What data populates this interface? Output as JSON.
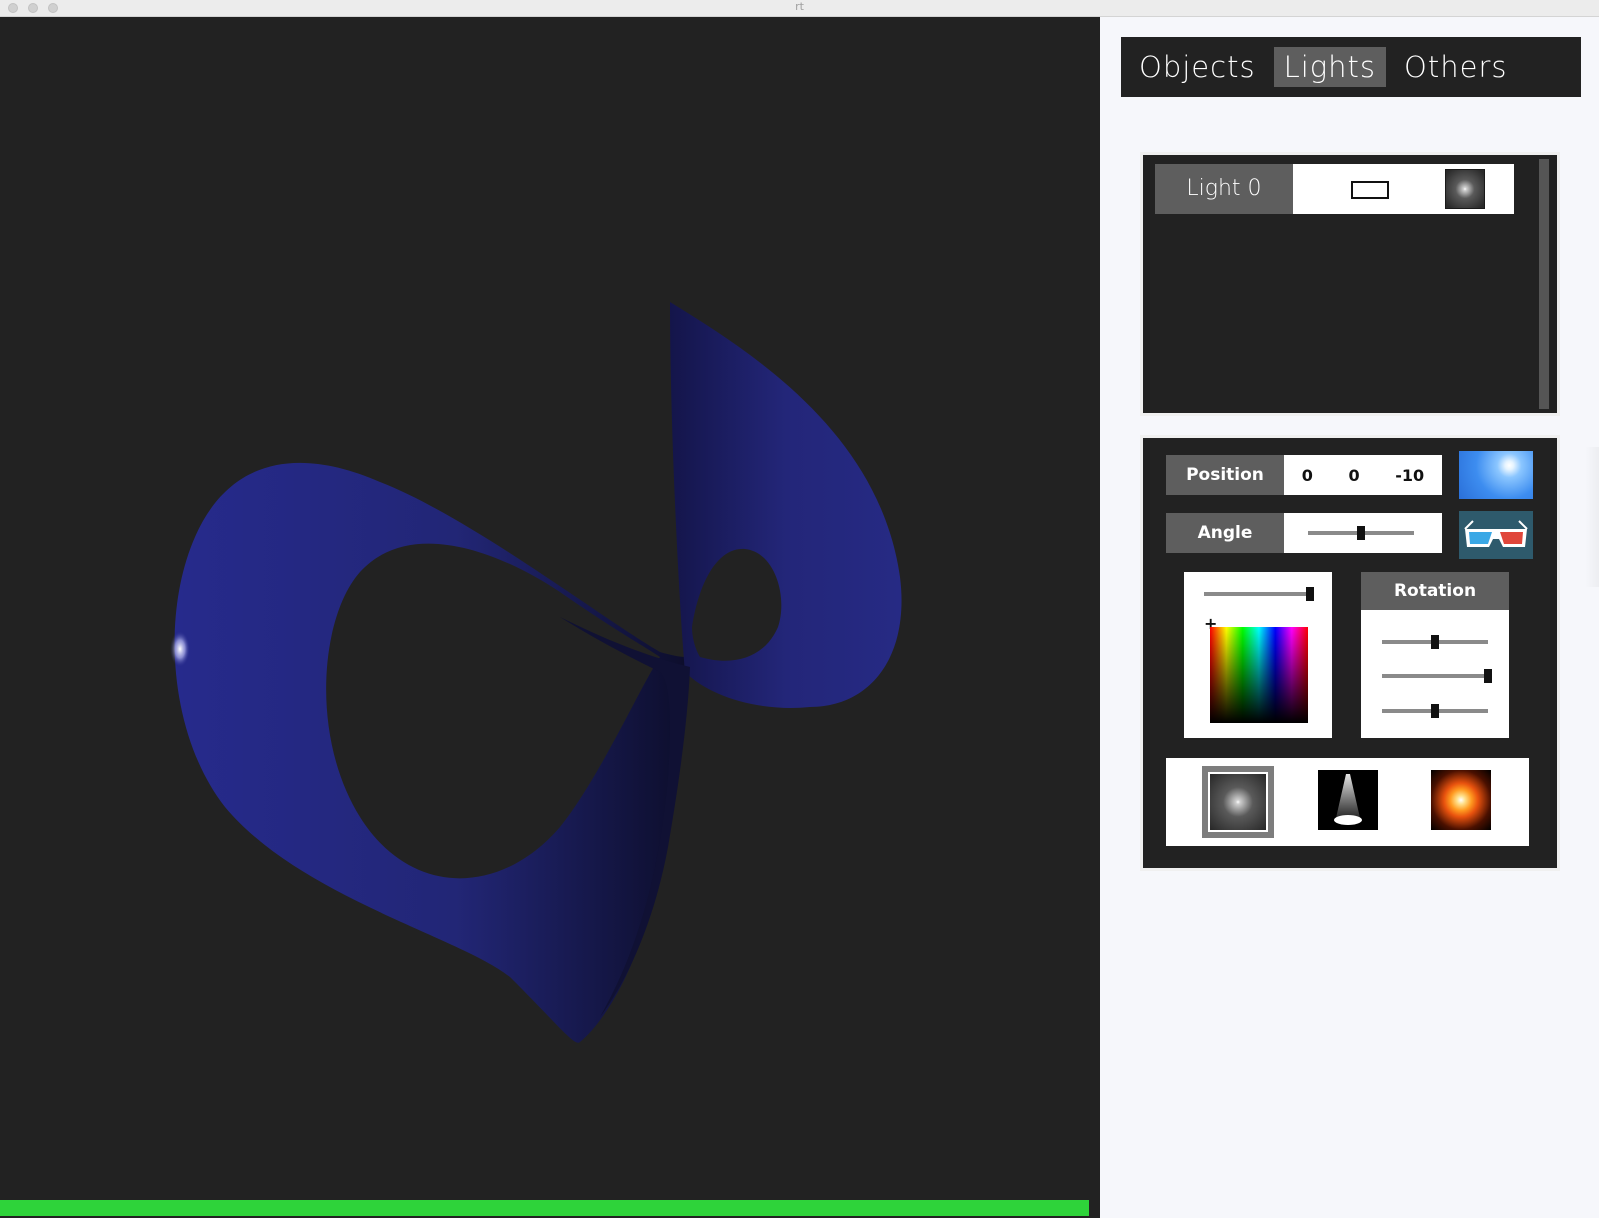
{
  "window": {
    "title": "rt"
  },
  "tabs": [
    {
      "label": "Objects",
      "active": false
    },
    {
      "label": "Lights",
      "active": true
    },
    {
      "label": "Others",
      "active": false
    }
  ],
  "lights_list": {
    "items": [
      {
        "label": "Light 0",
        "shape_icon": "rectangle-icon",
        "preview_icon": "point-light-icon"
      }
    ]
  },
  "properties": {
    "position": {
      "label": "Position",
      "x": "0",
      "y": "0",
      "z": "-10"
    },
    "angle": {
      "label": "Angle",
      "value": 0.5
    },
    "color": {
      "brightness": 1.0,
      "picker_marker": "+"
    },
    "rotation": {
      "title": "Rotation",
      "x": 0.5,
      "y": 1.0,
      "z": 0.5
    },
    "light_types": [
      {
        "name": "point-light-icon",
        "selected": true
      },
      {
        "name": "spot-light-icon",
        "selected": false
      },
      {
        "name": "sun-light-icon",
        "selected": false
      }
    ],
    "side_buttons": [
      "sky-sun-icon",
      "3d-glasses-icon"
    ]
  },
  "render": {
    "progress": 1.0,
    "colors": {
      "shape": "#232478",
      "background": "#222222",
      "progress": "#2ed33a"
    }
  }
}
